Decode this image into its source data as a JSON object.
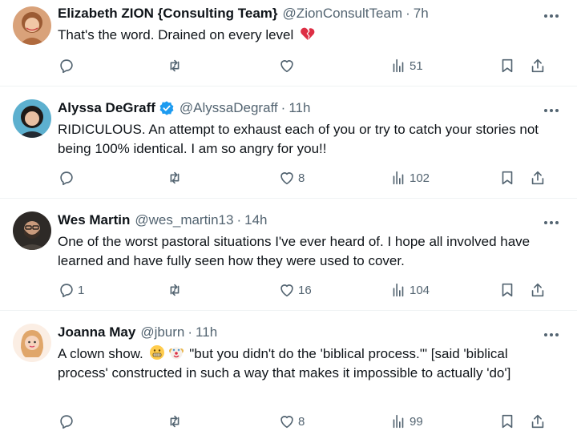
{
  "tweets": [
    {
      "name": "Elizabeth ZION {Consulting Team}",
      "handle": "@ZionConsultTeam",
      "sep": "·",
      "time": "7h",
      "text": "That's the word. Drained on every level",
      "replies": "",
      "likes": "",
      "views": "51",
      "verified": false,
      "avatar_color": "#c98a5e"
    },
    {
      "name": "Alyssa DeGraff",
      "handle": "@AlyssaDegraff",
      "sep": "·",
      "time": "11h",
      "text": "RIDICULOUS. An attempt to exhaust each of you or try to catch your stories not being 100% identical. I am so angry for you!!",
      "replies": "",
      "likes": "8",
      "views": "102",
      "verified": true,
      "avatar_color": "#4a9ebf"
    },
    {
      "name": "Wes Martin",
      "handle": "@wes_martin13",
      "sep": "·",
      "time": "14h",
      "text": "One of the worst pastoral situations I've ever heard of. I hope all involved have learned and have fully seen how they were used to cover.",
      "replies": "1",
      "likes": "16",
      "views": "104",
      "verified": false,
      "avatar_color": "#3c3835"
    },
    {
      "name": "Joanna May",
      "handle": "@jburn",
      "sep": "·",
      "time": "11h",
      "text_a": "A clown show.",
      "text_b": "\"but you didn't do the 'biblical process.'\" [said 'biblical process' constructed in such a way that makes it impossible to actually 'do']",
      "replies": "",
      "likes": "8",
      "views": "99",
      "verified": false,
      "avatar_color": "#f3d9c6"
    }
  ],
  "colors": {
    "text": "#0f1419",
    "secondary": "#536471",
    "verified": "#1d9bf0",
    "border": "#eff3f4"
  }
}
